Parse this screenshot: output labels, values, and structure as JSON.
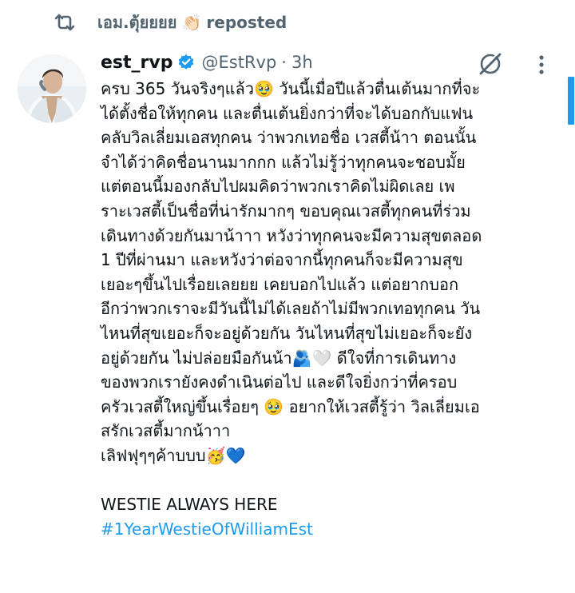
{
  "repost": {
    "user_name": "เอม.ตุ้ยยยย",
    "emoji": "👏🏻",
    "label": "reposted"
  },
  "author": {
    "name": "est_rvp",
    "handle": "@EstRvp",
    "separator": "·",
    "time": "3h"
  },
  "post": {
    "lines": [
      "ครบ 365 วันจริงๆแล้ว🥹 วันนี้เมื่อปีแล้วตื่นเต้นมากที่จะ",
      "ได้ตั้งชื่อให้ทุกคน และตื่นเต้นยิ่งกว่าที่จะได้บอกกับแฟน",
      "คลับวิลเลี่ยมเอสทุกคน ว่าพวกเทอชื่อ เวสตี้น้าา ตอนนั้น",
      "จำได้ว่าคิดชื่อนานมากกก แล้วไม่รู้ว่าทุกคนจะชอบมั้ย",
      "แต่ตอนนี้มองกลับไปผมคิดว่าพวกเราคิดไม่ผิดเลย เพ",
      "ราะเวสตี้เป็นชื่อที่น่ารักมากๆ ขอบคุณเวสตี้ทุกคนที่ร่วม",
      "เดินทางด้วยกันมาน้าาา หวังว่าทุกคนจะมีความสุขตลอด",
      "1 ปีที่ผ่านมา และหวังว่าต่อจากนี้ทุกคนก็จะมีความสุข",
      "เยอะๆขึ้นไปเรื่อยเลยยย เคยบอกไปแล้ว แต่อยากบอก",
      "อีกว่าพวกเราจะมีวันนี้ไม่ได้เลยถ้าไม่มีพวกเทอทุกคน วัน",
      "ไหนที่สุขเยอะก็จะอยู่ด้วยกัน วันไหนที่สุขไม่เยอะก็จะยัง",
      "อยู่ด้วยกัน ไม่ปล่อยมือกันน้า🫂🤍 ดีใจที่การเดินทาง",
      "ของพวกเรายังคงดำเนินต่อไป และดีใจยิ่งกว่าที่ครอบ",
      "ครัวเวสตี้ใหญ่ขึ้นเรื่อยๆ 🥹 อยากให้เวสตี้รู้ว่า วิลเลี่ยมเอ",
      "สรักเวสตี้มากน้าาา",
      "เลิฟฟุๆๆค้าบบบ🥳💙"
    ],
    "closing": "WESTIE ALWAYS HERE",
    "hashtag": "#1YearWestieOfWilliamEst"
  },
  "colors": {
    "text": "#0f1419",
    "secondary": "#536471",
    "accent": "#1d9bf0"
  },
  "icons": {
    "repost": "repost-icon",
    "verified": "verified-badge-icon",
    "grok": "grok-icon",
    "more": "more-vertical-icon"
  }
}
